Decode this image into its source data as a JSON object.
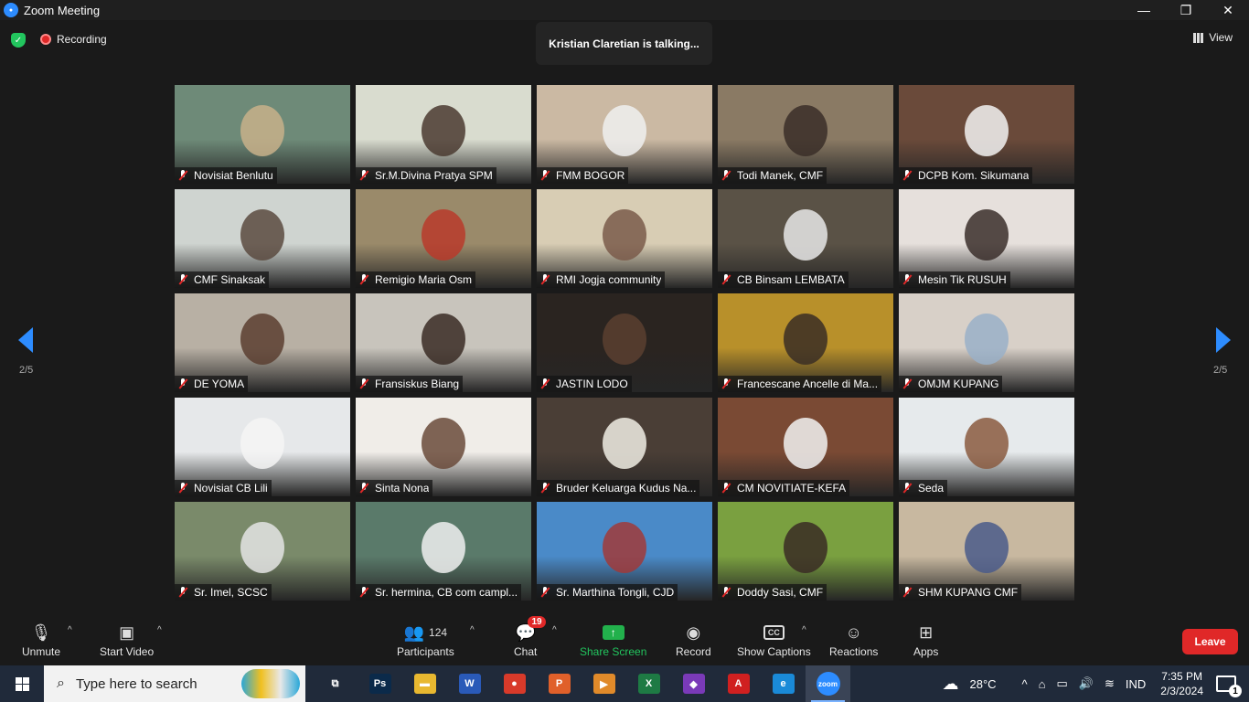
{
  "window": {
    "title": "Zoom Meeting",
    "minimize": "—",
    "maximize": "❐",
    "close": "✕"
  },
  "topbar": {
    "recording_label": "Recording",
    "talking": "Kristian Claretian is talking...",
    "view_label": "View"
  },
  "pager": {
    "left": "2/5",
    "right": "2/5"
  },
  "tiles": [
    {
      "name": "Novisiat Benlutu",
      "bg": "#6e8a78",
      "accent": "#c8b08a"
    },
    {
      "name": "Sr.M.Divina Pratya SPM",
      "bg": "#d9dccf",
      "accent": "#4a3a30"
    },
    {
      "name": "FMM BOGOR",
      "bg": "#cbb9a3",
      "accent": "#f0f0f0"
    },
    {
      "name": "Todi Manek, CMF",
      "bg": "#8a7a64",
      "accent": "#3a2e28"
    },
    {
      "name": "DCPB Kom. Sikumana",
      "bg": "#6a4a3a",
      "accent": "#f2f2f2"
    },
    {
      "name": "CMF Sinaksak",
      "bg": "#cfd4d0",
      "accent": "#5a4a40"
    },
    {
      "name": "Remigio Maria Osm",
      "bg": "#9a8a6a",
      "accent": "#b83a2a"
    },
    {
      "name": "RMI Jogja community",
      "bg": "#d8cdb4",
      "accent": "#7a5a4a"
    },
    {
      "name": "CB Binsam LEMBATA",
      "bg": "#5a5246",
      "accent": "#e8e8e8"
    },
    {
      "name": "Mesin Tik RUSUH",
      "bg": "#e6e0dc",
      "accent": "#3a2e2a"
    },
    {
      "name": "DE YOMA",
      "bg": "#b8b0a4",
      "accent": "#5a3e30"
    },
    {
      "name": "Fransiskus Biang",
      "bg": "#c8c4bc",
      "accent": "#3a2c24"
    },
    {
      "name": "JASTIN LODO",
      "bg": "#2a2420",
      "accent": "#5a4030"
    },
    {
      "name": "Francescane Ancelle di Ma...",
      "bg": "#b8902a",
      "accent": "#3a2e24"
    },
    {
      "name": "OMJM KUPANG",
      "bg": "#d8d0c8",
      "accent": "#9ab0c8"
    },
    {
      "name": "Novisiat CB Lili",
      "bg": "#e6e8ea",
      "accent": "#f4f4f4"
    },
    {
      "name": "Sinta Nona",
      "bg": "#f0ede8",
      "accent": "#6a4a3a"
    },
    {
      "name": "Bruder Keluarga Kudus Na...",
      "bg": "#4a3e36",
      "accent": "#f0ede4"
    },
    {
      "name": "CM NOVITIATE-KEFA",
      "bg": "#7a4a34",
      "accent": "#f2f2f2"
    },
    {
      "name": "Seda",
      "bg": "#e6eaec",
      "accent": "#8a5a40"
    },
    {
      "name": "Sr. Imel, SCSC",
      "bg": "#7a8a6a",
      "accent": "#e4e4e4"
    },
    {
      "name": "Sr. hermina, CB com campl...",
      "bg": "#5a7a6a",
      "accent": "#f0f0f0"
    },
    {
      "name": "Sr. Marthina Tongli, CJD",
      "bg": "#4a8ac8",
      "accent": "#a03a3a"
    },
    {
      "name": "Doddy Sasi, CMF",
      "bg": "#7aa040",
      "accent": "#3a2c24"
    },
    {
      "name": "SHM KUPANG CMF",
      "bg": "#c8b8a0",
      "accent": "#4a5a8a"
    }
  ],
  "toolbar": {
    "unmute": "Unmute",
    "start_video": "Start Video",
    "participants": "Participants",
    "participants_count": "124",
    "chat": "Chat",
    "chat_badge": "19",
    "share": "Share Screen",
    "record": "Record",
    "captions": "Show Captions",
    "reactions": "Reactions",
    "apps": "Apps",
    "leave": "Leave"
  },
  "taskbar": {
    "search_placeholder": "Type here to search",
    "weather": "28°C",
    "lang": "IND",
    "time": "7:35 PM",
    "date": "2/3/2024",
    "notification_count": "1",
    "apps": [
      {
        "icon": "task-view-icon",
        "color": "#202a3a",
        "glyph": "⧉"
      },
      {
        "icon": "photoshop-icon",
        "color": "#0b2a4a",
        "glyph": "Ps"
      },
      {
        "icon": "file-explorer-icon",
        "color": "#e8b830",
        "glyph": "▬"
      },
      {
        "icon": "word-icon",
        "color": "#2a5ab8",
        "glyph": "W"
      },
      {
        "icon": "chrome-icon",
        "color": "#d83a2a",
        "glyph": "●"
      },
      {
        "icon": "presentation-icon",
        "color": "#e0602a",
        "glyph": "P"
      },
      {
        "icon": "media-player-icon",
        "color": "#e08a2a",
        "glyph": "▶"
      },
      {
        "icon": "excel-icon",
        "color": "#1e7a44",
        "glyph": "X"
      },
      {
        "icon": "visual-studio-icon",
        "color": "#7a3ab8",
        "glyph": "◆"
      },
      {
        "icon": "pdf-icon",
        "color": "#d02020",
        "glyph": "A"
      },
      {
        "icon": "edge-icon",
        "color": "#1a8ad8",
        "glyph": "e"
      },
      {
        "icon": "zoom-icon",
        "color": "#2d8cff",
        "glyph": "zoom"
      }
    ]
  }
}
